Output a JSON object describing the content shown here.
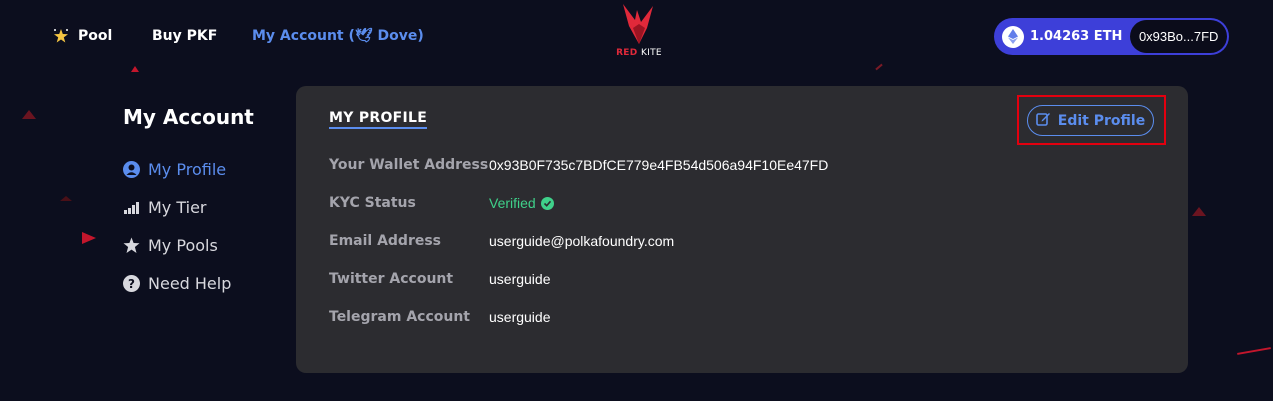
{
  "header": {
    "nav": {
      "pool": "Pool",
      "buy": "Buy PKF",
      "account": "My Account (🕊 Dove)"
    },
    "logo": {
      "red": "RED",
      "kite": "KITE"
    },
    "wallet": {
      "balance": "1.04263 ETH",
      "address": "0x93Bo...7FD"
    }
  },
  "sidebar": {
    "title": "My Account",
    "items": [
      {
        "label": "My Profile",
        "icon": "user-circle-icon",
        "active": true
      },
      {
        "label": "My Tier",
        "icon": "signal-bars-icon",
        "active": false
      },
      {
        "label": "My Pools",
        "icon": "star-icon",
        "active": false
      },
      {
        "label": "Need Help",
        "icon": "question-circle-icon",
        "active": false
      }
    ]
  },
  "profile": {
    "title": "MY PROFILE",
    "edit_label": "Edit Profile",
    "rows": [
      {
        "label": "Your Wallet Address",
        "value": "0x93B0F735c7BDfCE779e4FB54d506a94F10Ee47FD"
      },
      {
        "label": "KYC Status",
        "value": "Verified"
      },
      {
        "label": "Email Address",
        "value": "userguide@polkafoundry.com"
      },
      {
        "label": "Twitter Account",
        "value": "userguide"
      },
      {
        "label": "Telegram Account",
        "value": "userguide"
      }
    ]
  },
  "colors": {
    "background": "#0c0e1e",
    "card": "#2c2c30",
    "accent": "#5b8dee",
    "wallet": "#3d3fd9",
    "verified": "#3fd18a",
    "brand_red": "#e0293a",
    "highlight": "#e3000f"
  }
}
